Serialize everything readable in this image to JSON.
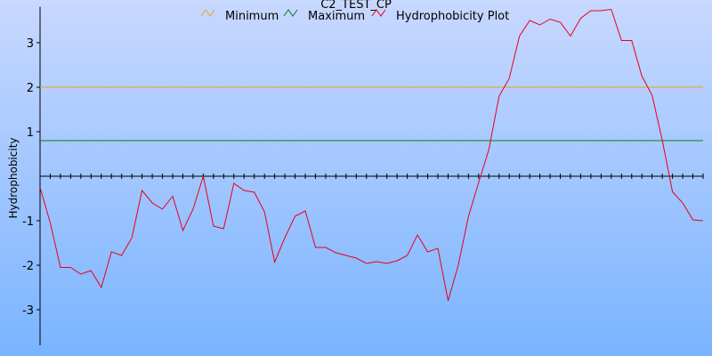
{
  "chart_data": {
    "type": "line",
    "title": "C2_TEST_CP",
    "xlabel": "",
    "ylabel": "Hydrophobicity",
    "ylim": [
      -3.8,
      3.75
    ],
    "yticks": [
      -3,
      -2,
      -1,
      1,
      2,
      3
    ],
    "ytick_labels": [
      "-3",
      "-2",
      "-1",
      "1",
      "2",
      "3"
    ],
    "legend_position": "top",
    "colors": {
      "minimum": "#e8a030",
      "maximum": "#007a1e",
      "plot": "#e8001c"
    },
    "series": [
      {
        "name": "Minimum",
        "kind": "hline",
        "value": 2.0
      },
      {
        "name": "Maximum",
        "kind": "hline",
        "value": 0.8
      },
      {
        "name": "Hydrophobicity Plot",
        "kind": "line",
        "x": [
          0,
          1,
          2,
          3,
          4,
          5,
          6,
          7,
          8,
          9,
          10,
          11,
          12,
          13,
          14,
          15,
          16,
          17,
          18,
          19,
          20,
          21,
          22,
          23,
          24,
          25,
          26,
          27,
          28,
          29,
          30,
          31,
          32,
          33,
          34,
          35,
          36,
          37,
          38,
          39,
          40,
          41,
          42,
          43,
          44,
          45,
          46,
          47,
          48,
          49,
          50,
          51,
          52,
          53,
          54,
          55,
          56,
          57,
          58,
          59,
          60,
          61,
          62,
          63,
          64,
          65
        ],
        "values": [
          -0.25,
          -1.05,
          -2.05,
          -2.05,
          -2.2,
          -2.12,
          -2.5,
          -1.7,
          -1.78,
          -1.38,
          -0.32,
          -0.6,
          -0.74,
          -0.45,
          -1.22,
          -0.74,
          0.0,
          -1.12,
          -1.18,
          -0.16,
          -0.32,
          -0.36,
          -0.8,
          -1.93,
          -1.38,
          -0.9,
          -0.78,
          -1.6,
          -1.6,
          -1.72,
          -1.78,
          -1.84,
          -1.96,
          -1.92,
          -1.96,
          -1.9,
          -1.78,
          -1.32,
          -1.7,
          -1.62,
          -2.8,
          -2.0,
          -0.9,
          -0.14,
          0.6,
          1.8,
          2.2,
          3.15,
          3.5,
          3.4,
          3.53,
          3.46,
          3.15,
          3.55,
          3.72,
          3.72,
          3.75,
          3.05,
          3.05,
          2.25,
          1.82,
          0.8,
          -0.35,
          -0.6,
          -0.98,
          -1.0
        ]
      }
    ]
  }
}
